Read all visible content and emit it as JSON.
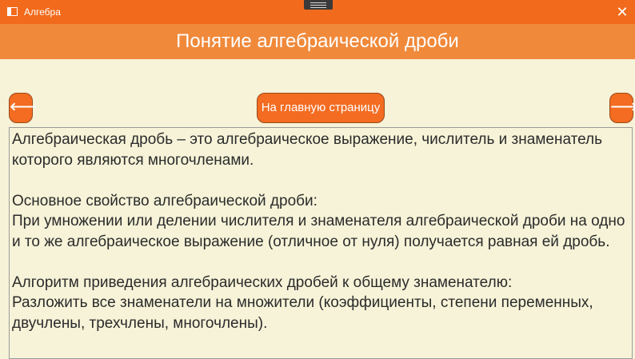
{
  "window": {
    "title": "Алгебра",
    "close_symbol": "✕"
  },
  "header": {
    "title": "Понятие алгебраической дроби"
  },
  "nav": {
    "back_symbol": "⟵",
    "home_label": "На главную страницу",
    "forward_symbol": "⟶"
  },
  "content": {
    "text": "Алгебраическая дробь – это алгебраическое выражение, числитель и знаменатель которого являются многочленами.\n\nОсновное свойство алгебраической дроби:\nПри умножении или делении числителя и знаменателя алгебраической дроби на одно и то же алгебраическое выражение (отличное от нуля) получается равная ей дробь.\n\nАлгоритм приведения алгебраических дробей к общему знаменателю:\nРазложить все знаменатели на множители (коэффициенты, степени переменных, двучлены, трехчлены, многочлены)."
  },
  "colors": {
    "titlebar": "#f26a1b",
    "header": "#f0893a",
    "button": "#f36c21",
    "background": "#f6f3d8",
    "text": "#2b2b2b"
  },
  "icons": {
    "app": "window-icon",
    "grip": "drag-handle-icon",
    "close": "close-icon",
    "back": "arrow-left-icon",
    "forward": "arrow-right-icon"
  }
}
